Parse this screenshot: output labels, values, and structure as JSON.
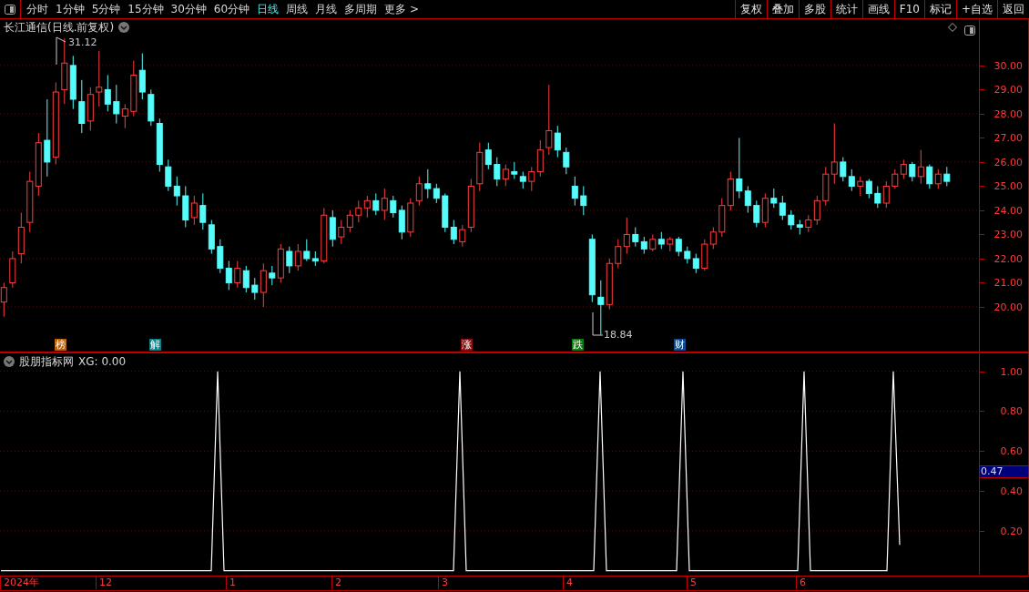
{
  "toolbar": {
    "tabs": [
      {
        "label": "分时",
        "selected": false
      },
      {
        "label": "1分钟",
        "selected": false
      },
      {
        "label": "5分钟",
        "selected": false
      },
      {
        "label": "15分钟",
        "selected": false
      },
      {
        "label": "30分钟",
        "selected": false
      },
      {
        "label": "60分钟",
        "selected": false
      },
      {
        "label": "日线",
        "selected": true
      },
      {
        "label": "周线",
        "selected": false
      },
      {
        "label": "月线",
        "selected": false
      },
      {
        "label": "多周期",
        "selected": false
      },
      {
        "label": "更多 >",
        "selected": false
      }
    ],
    "buttons": [
      "复权",
      "叠加",
      "多股",
      "统计",
      "画线",
      "F10",
      "标记",
      "+自选",
      "返回"
    ]
  },
  "price_panel": {
    "title": "长江通信(日线.前复权)",
    "high_label": "31.12",
    "low_label": "18.84",
    "markers": [
      {
        "label": "榜",
        "color": "#b8600c"
      },
      {
        "label": "解",
        "color": "#0a7f86"
      },
      {
        "label": "涨",
        "color": "#8c0c0c"
      },
      {
        "label": "跌",
        "color": "#0c7a0c"
      },
      {
        "label": "财",
        "color": "#0c4a8c"
      }
    ],
    "chart_data": {
      "type": "candlestick",
      "ylim": [
        18.15,
        31.92
      ],
      "grid": true,
      "yticks": [
        {
          "value": 30,
          "label": "30.00"
        },
        {
          "value": 29,
          "label": "29.00"
        },
        {
          "value": 28,
          "label": "28.00"
        },
        {
          "value": 27,
          "label": "27.00"
        },
        {
          "value": 26,
          "label": "26.00"
        },
        {
          "value": 25,
          "label": "25.00"
        },
        {
          "value": 24,
          "label": "24.00"
        },
        {
          "value": 23,
          "label": "23.00"
        },
        {
          "value": 22,
          "label": "22.00"
        },
        {
          "value": 21,
          "label": "21.00"
        },
        {
          "value": 20,
          "label": "20.00"
        }
      ],
      "categories": [
        null,
        null,
        null,
        null,
        null,
        null,
        null,
        null,
        null,
        null,
        null,
        null,
        null,
        null,
        null,
        null,
        null,
        null,
        null,
        null,
        null,
        null,
        null,
        null,
        null,
        null,
        null,
        null,
        null,
        null,
        null,
        null,
        null,
        null,
        null,
        null,
        null,
        null,
        null,
        null,
        null,
        null,
        null,
        null,
        null,
        null,
        null,
        null,
        null,
        null,
        null,
        null,
        null,
        null,
        null,
        null,
        null,
        null,
        null,
        null,
        null,
        null,
        null,
        null,
        null,
        null,
        null,
        null,
        null,
        null,
        null,
        null,
        null,
        null,
        null,
        null,
        null,
        null,
        null,
        null,
        null,
        null,
        null,
        null,
        null,
        null,
        null,
        null,
        null,
        null,
        null,
        null,
        null,
        null,
        null,
        null,
        null,
        null,
        null,
        null,
        null,
        null,
        null,
        null,
        null,
        null,
        null,
        null,
        null,
        null
      ],
      "ohlc": [
        [
          20.2,
          21.0,
          19.6,
          20.8
        ],
        [
          21.0,
          22.3,
          20.8,
          22.0
        ],
        [
          22.2,
          23.9,
          21.8,
          23.3
        ],
        [
          23.5,
          25.6,
          23.1,
          25.2
        ],
        [
          25.0,
          27.2,
          24.6,
          26.8
        ],
        [
          26.9,
          28.6,
          25.4,
          26.0
        ],
        [
          26.2,
          29.3,
          25.9,
          28.9
        ],
        [
          29.0,
          31.12,
          28.4,
          30.1
        ],
        [
          30.0,
          30.4,
          28.2,
          28.6
        ],
        [
          28.5,
          29.4,
          27.2,
          27.6
        ],
        [
          27.7,
          29.1,
          27.3,
          28.8
        ],
        [
          28.9,
          30.6,
          28.3,
          29.1
        ],
        [
          29.0,
          29.6,
          28.1,
          28.4
        ],
        [
          28.5,
          29.2,
          27.6,
          28.0
        ],
        [
          27.9,
          28.4,
          27.4,
          28.2
        ],
        [
          28.1,
          30.2,
          27.9,
          29.6
        ],
        [
          29.8,
          30.5,
          28.6,
          28.9
        ],
        [
          28.8,
          29.0,
          27.5,
          27.7
        ],
        [
          27.6,
          27.8,
          25.6,
          25.9
        ],
        [
          25.8,
          26.1,
          24.8,
          25.0
        ],
        [
          25.0,
          25.4,
          24.2,
          24.6
        ],
        [
          24.6,
          25.0,
          23.3,
          23.6
        ],
        [
          23.7,
          24.6,
          23.4,
          24.3
        ],
        [
          24.2,
          24.7,
          23.2,
          23.5
        ],
        [
          23.4,
          23.6,
          22.2,
          22.4
        ],
        [
          22.5,
          22.8,
          21.4,
          21.6
        ],
        [
          21.6,
          21.9,
          20.7,
          21.0
        ],
        [
          21.0,
          21.9,
          20.8,
          21.6
        ],
        [
          21.5,
          21.7,
          20.6,
          20.8
        ],
        [
          20.9,
          21.2,
          20.3,
          20.6
        ],
        [
          20.6,
          21.8,
          20.0,
          21.5
        ],
        [
          21.4,
          21.7,
          20.9,
          21.2
        ],
        [
          21.2,
          22.6,
          21.0,
          22.4
        ],
        [
          22.3,
          22.5,
          21.4,
          21.7
        ],
        [
          21.7,
          22.6,
          21.5,
          22.3
        ],
        [
          22.3,
          22.8,
          21.9,
          22.0
        ],
        [
          22.0,
          22.3,
          21.7,
          21.9
        ],
        [
          21.9,
          24.1,
          21.8,
          23.8
        ],
        [
          23.7,
          24.0,
          22.5,
          22.8
        ],
        [
          22.9,
          23.6,
          22.6,
          23.3
        ],
        [
          23.3,
          24.0,
          23.1,
          23.8
        ],
        [
          23.8,
          24.4,
          23.5,
          24.1
        ],
        [
          24.1,
          24.6,
          23.7,
          24.4
        ],
        [
          24.4,
          24.7,
          23.8,
          24.0
        ],
        [
          24.0,
          24.9,
          23.6,
          24.5
        ],
        [
          24.4,
          24.6,
          23.7,
          23.9
        ],
        [
          24.0,
          24.2,
          22.8,
          23.1
        ],
        [
          23.1,
          24.5,
          22.9,
          24.3
        ],
        [
          24.4,
          25.4,
          24.2,
          25.1
        ],
        [
          25.1,
          25.7,
          24.5,
          24.9
        ],
        [
          24.9,
          25.1,
          24.3,
          24.5
        ],
        [
          24.6,
          24.7,
          23.1,
          23.3
        ],
        [
          23.3,
          23.6,
          22.6,
          22.8
        ],
        [
          22.7,
          23.4,
          22.5,
          23.2
        ],
        [
          23.3,
          25.3,
          23.1,
          25.0
        ],
        [
          25.1,
          26.8,
          24.8,
          26.4
        ],
        [
          26.5,
          26.8,
          25.7,
          25.9
        ],
        [
          25.9,
          26.2,
          25.0,
          25.3
        ],
        [
          25.3,
          25.9,
          25.0,
          25.7
        ],
        [
          25.6,
          26.0,
          25.3,
          25.5
        ],
        [
          25.4,
          25.6,
          24.9,
          25.2
        ],
        [
          25.2,
          25.8,
          24.8,
          25.6
        ],
        [
          25.6,
          26.9,
          25.4,
          26.5
        ],
        [
          26.6,
          29.2,
          26.3,
          27.3
        ],
        [
          27.2,
          27.5,
          26.2,
          26.5
        ],
        [
          26.4,
          26.6,
          25.5,
          25.8
        ],
        [
          25.0,
          25.4,
          24.2,
          24.5
        ],
        [
          24.6,
          25.0,
          23.8,
          24.2
        ],
        [
          22.8,
          23.0,
          20.2,
          20.5
        ],
        [
          20.4,
          21.1,
          18.84,
          20.1
        ],
        [
          20.1,
          22.0,
          19.9,
          21.8
        ],
        [
          21.8,
          22.8,
          21.6,
          22.5
        ],
        [
          22.5,
          23.7,
          22.2,
          23.0
        ],
        [
          23.0,
          23.3,
          22.5,
          22.7
        ],
        [
          22.7,
          22.9,
          22.2,
          22.4
        ],
        [
          22.4,
          23.0,
          22.3,
          22.8
        ],
        [
          22.8,
          23.1,
          22.4,
          22.6
        ],
        [
          22.6,
          22.9,
          22.3,
          22.8
        ],
        [
          22.8,
          22.9,
          22.1,
          22.3
        ],
        [
          22.3,
          22.5,
          21.8,
          22.0
        ],
        [
          22.0,
          22.2,
          21.4,
          21.6
        ],
        [
          21.6,
          22.8,
          21.5,
          22.6
        ],
        [
          22.6,
          23.3,
          22.4,
          23.1
        ],
        [
          23.1,
          24.5,
          22.9,
          24.2
        ],
        [
          24.2,
          25.6,
          24.0,
          25.3
        ],
        [
          25.3,
          27.0,
          24.5,
          24.8
        ],
        [
          24.8,
          25.0,
          23.9,
          24.2
        ],
        [
          24.2,
          24.4,
          23.3,
          23.5
        ],
        [
          23.5,
          24.7,
          23.3,
          24.5
        ],
        [
          24.5,
          24.9,
          24.1,
          24.3
        ],
        [
          24.3,
          24.6,
          23.6,
          23.8
        ],
        [
          23.8,
          24.0,
          23.2,
          23.4
        ],
        [
          23.4,
          23.6,
          23.0,
          23.3
        ],
        [
          23.3,
          23.8,
          23.1,
          23.6
        ],
        [
          23.6,
          24.6,
          23.4,
          24.4
        ],
        [
          24.4,
          25.8,
          24.2,
          25.5
        ],
        [
          25.5,
          27.6,
          25.1,
          26.0
        ],
        [
          26.0,
          26.2,
          25.2,
          25.4
        ],
        [
          25.4,
          25.7,
          24.8,
          25.0
        ],
        [
          25.0,
          25.4,
          24.6,
          25.2
        ],
        [
          25.2,
          25.3,
          24.5,
          24.7
        ],
        [
          24.7,
          25.0,
          24.1,
          24.3
        ],
        [
          24.3,
          25.2,
          24.1,
          25.0
        ],
        [
          25.0,
          25.7,
          24.9,
          25.5
        ],
        [
          25.5,
          26.1,
          25.3,
          25.9
        ],
        [
          25.9,
          26.0,
          25.2,
          25.4
        ],
        [
          25.4,
          26.5,
          25.1,
          25.8
        ],
        [
          25.8,
          25.9,
          24.9,
          25.1
        ],
        [
          25.1,
          25.7,
          24.9,
          25.5
        ],
        [
          25.5,
          25.8,
          25.0,
          25.2
        ]
      ]
    }
  },
  "indicator_panel": {
    "title": "股朋指标网",
    "reading": "XG: 0.00",
    "cursor_value": "0.47",
    "chart_data": {
      "type": "line",
      "ylim": [
        -0.02,
        1.09
      ],
      "grid": true,
      "yticks": [
        {
          "value": 1.0,
          "label": "1.00"
        },
        {
          "value": 0.8,
          "label": "0.80"
        },
        {
          "value": 0.6,
          "label": "0.60"
        },
        {
          "value": 0.4,
          "label": "0.40"
        },
        {
          "value": 0.2,
          "label": "0.20"
        }
      ],
      "categories": [
        null,
        null,
        null,
        null,
        null,
        null,
        null,
        null,
        null,
        null,
        null,
        null,
        null,
        null,
        null,
        null,
        null,
        null,
        null,
        null,
        null,
        null,
        null,
        null,
        null,
        null,
        null,
        null,
        null,
        null,
        null,
        null,
        null,
        null,
        null,
        null,
        null,
        null,
        null,
        null,
        null,
        null,
        null,
        null,
        null,
        null,
        null,
        null,
        null,
        null,
        null,
        null,
        null,
        null,
        null,
        null,
        null,
        null,
        null,
        null,
        null,
        null,
        null,
        null,
        null,
        null,
        null,
        null,
        null,
        null,
        null,
        null,
        null,
        null,
        null,
        null,
        null,
        null,
        null,
        null,
        null,
        null,
        null,
        null,
        null,
        null,
        null,
        null,
        null,
        null,
        null,
        null,
        null,
        null,
        null,
        null,
        null,
        null,
        null,
        null,
        null,
        null,
        null,
        null,
        null,
        null,
        null,
        null,
        null,
        null,
        null,
        null,
        null,
        null,
        null,
        null,
        null,
        null,
        null,
        null,
        null,
        null,
        null,
        null,
        null,
        null,
        null,
        null,
        null,
        null,
        null,
        null,
        null,
        null,
        null,
        null,
        null,
        null,
        null,
        null,
        null,
        null
      ],
      "series": [
        {
          "color": "#ffffff",
          "values": [
            0,
            0,
            0,
            0,
            0,
            0,
            0,
            0,
            0,
            0,
            0,
            0,
            0,
            0,
            0,
            0,
            0,
            0,
            0,
            0,
            0,
            0,
            0,
            0,
            0,
            0,
            0,
            0,
            0,
            0,
            0,
            0,
            0,
            0,
            1,
            0,
            0,
            0,
            0,
            0,
            0,
            0,
            0,
            0,
            0,
            0,
            0,
            0,
            0,
            0,
            0,
            0,
            0,
            0,
            0,
            0,
            0,
            0,
            0,
            0,
            0,
            0,
            0,
            0,
            0,
            0,
            0,
            0,
            0,
            0,
            0,
            0,
            1,
            0,
            0,
            0,
            0,
            0,
            0,
            0,
            0,
            0,
            0,
            0,
            0,
            0,
            0,
            0,
            0,
            0,
            0,
            0,
            0,
            0,
            1,
            0,
            0,
            0,
            0,
            0,
            0,
            0,
            0,
            0,
            0,
            0,
            0,
            1,
            0,
            0,
            0,
            0,
            0,
            0,
            0,
            0,
            0,
            0,
            0,
            0,
            0,
            0,
            0,
            0,
            0,
            0,
            1,
            0,
            0,
            0,
            0,
            0,
            0,
            0,
            0,
            0,
            0,
            0,
            0,
            0,
            1,
            0.13
          ]
        }
      ]
    }
  },
  "date_axis": [
    "2024年",
    "12",
    "1",
    "2",
    "3",
    "4",
    "5",
    "6"
  ]
}
